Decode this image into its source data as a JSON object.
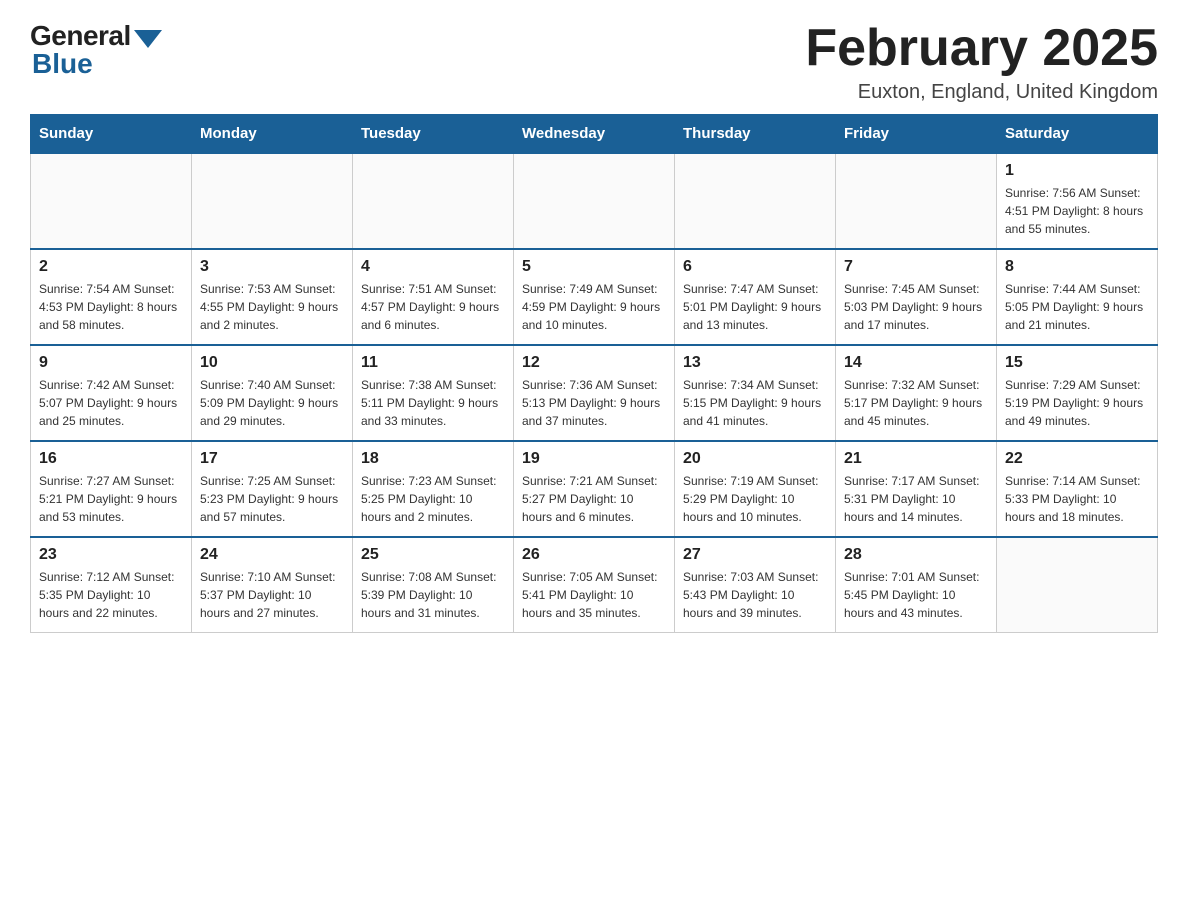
{
  "logo": {
    "general": "General",
    "blue": "Blue"
  },
  "header": {
    "title": "February 2025",
    "location": "Euxton, England, United Kingdom"
  },
  "days_of_week": [
    "Sunday",
    "Monday",
    "Tuesday",
    "Wednesday",
    "Thursday",
    "Friday",
    "Saturday"
  ],
  "weeks": [
    [
      {
        "day": "",
        "info": ""
      },
      {
        "day": "",
        "info": ""
      },
      {
        "day": "",
        "info": ""
      },
      {
        "day": "",
        "info": ""
      },
      {
        "day": "",
        "info": ""
      },
      {
        "day": "",
        "info": ""
      },
      {
        "day": "1",
        "info": "Sunrise: 7:56 AM\nSunset: 4:51 PM\nDaylight: 8 hours and 55 minutes."
      }
    ],
    [
      {
        "day": "2",
        "info": "Sunrise: 7:54 AM\nSunset: 4:53 PM\nDaylight: 8 hours and 58 minutes."
      },
      {
        "day": "3",
        "info": "Sunrise: 7:53 AM\nSunset: 4:55 PM\nDaylight: 9 hours and 2 minutes."
      },
      {
        "day": "4",
        "info": "Sunrise: 7:51 AM\nSunset: 4:57 PM\nDaylight: 9 hours and 6 minutes."
      },
      {
        "day": "5",
        "info": "Sunrise: 7:49 AM\nSunset: 4:59 PM\nDaylight: 9 hours and 10 minutes."
      },
      {
        "day": "6",
        "info": "Sunrise: 7:47 AM\nSunset: 5:01 PM\nDaylight: 9 hours and 13 minutes."
      },
      {
        "day": "7",
        "info": "Sunrise: 7:45 AM\nSunset: 5:03 PM\nDaylight: 9 hours and 17 minutes."
      },
      {
        "day": "8",
        "info": "Sunrise: 7:44 AM\nSunset: 5:05 PM\nDaylight: 9 hours and 21 minutes."
      }
    ],
    [
      {
        "day": "9",
        "info": "Sunrise: 7:42 AM\nSunset: 5:07 PM\nDaylight: 9 hours and 25 minutes."
      },
      {
        "day": "10",
        "info": "Sunrise: 7:40 AM\nSunset: 5:09 PM\nDaylight: 9 hours and 29 minutes."
      },
      {
        "day": "11",
        "info": "Sunrise: 7:38 AM\nSunset: 5:11 PM\nDaylight: 9 hours and 33 minutes."
      },
      {
        "day": "12",
        "info": "Sunrise: 7:36 AM\nSunset: 5:13 PM\nDaylight: 9 hours and 37 minutes."
      },
      {
        "day": "13",
        "info": "Sunrise: 7:34 AM\nSunset: 5:15 PM\nDaylight: 9 hours and 41 minutes."
      },
      {
        "day": "14",
        "info": "Sunrise: 7:32 AM\nSunset: 5:17 PM\nDaylight: 9 hours and 45 minutes."
      },
      {
        "day": "15",
        "info": "Sunrise: 7:29 AM\nSunset: 5:19 PM\nDaylight: 9 hours and 49 minutes."
      }
    ],
    [
      {
        "day": "16",
        "info": "Sunrise: 7:27 AM\nSunset: 5:21 PM\nDaylight: 9 hours and 53 minutes."
      },
      {
        "day": "17",
        "info": "Sunrise: 7:25 AM\nSunset: 5:23 PM\nDaylight: 9 hours and 57 minutes."
      },
      {
        "day": "18",
        "info": "Sunrise: 7:23 AM\nSunset: 5:25 PM\nDaylight: 10 hours and 2 minutes."
      },
      {
        "day": "19",
        "info": "Sunrise: 7:21 AM\nSunset: 5:27 PM\nDaylight: 10 hours and 6 minutes."
      },
      {
        "day": "20",
        "info": "Sunrise: 7:19 AM\nSunset: 5:29 PM\nDaylight: 10 hours and 10 minutes."
      },
      {
        "day": "21",
        "info": "Sunrise: 7:17 AM\nSunset: 5:31 PM\nDaylight: 10 hours and 14 minutes."
      },
      {
        "day": "22",
        "info": "Sunrise: 7:14 AM\nSunset: 5:33 PM\nDaylight: 10 hours and 18 minutes."
      }
    ],
    [
      {
        "day": "23",
        "info": "Sunrise: 7:12 AM\nSunset: 5:35 PM\nDaylight: 10 hours and 22 minutes."
      },
      {
        "day": "24",
        "info": "Sunrise: 7:10 AM\nSunset: 5:37 PM\nDaylight: 10 hours and 27 minutes."
      },
      {
        "day": "25",
        "info": "Sunrise: 7:08 AM\nSunset: 5:39 PM\nDaylight: 10 hours and 31 minutes."
      },
      {
        "day": "26",
        "info": "Sunrise: 7:05 AM\nSunset: 5:41 PM\nDaylight: 10 hours and 35 minutes."
      },
      {
        "day": "27",
        "info": "Sunrise: 7:03 AM\nSunset: 5:43 PM\nDaylight: 10 hours and 39 minutes."
      },
      {
        "day": "28",
        "info": "Sunrise: 7:01 AM\nSunset: 5:45 PM\nDaylight: 10 hours and 43 minutes."
      },
      {
        "day": "",
        "info": ""
      }
    ]
  ]
}
